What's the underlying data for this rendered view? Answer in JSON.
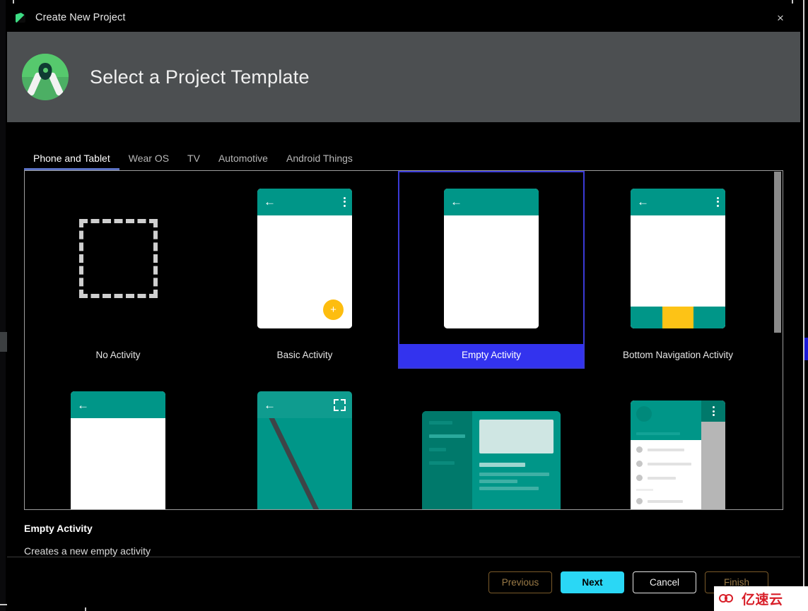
{
  "window": {
    "title": "Create New Project",
    "app_icon": "android-studio-icon",
    "close_label": "×"
  },
  "header": {
    "title": "Select a Project Template",
    "logo": "android-studio-logo"
  },
  "tabs": [
    {
      "label": "Phone and Tablet",
      "active": true
    },
    {
      "label": "Wear OS",
      "active": false
    },
    {
      "label": "TV",
      "active": false
    },
    {
      "label": "Automotive",
      "active": false
    },
    {
      "label": "Android Things",
      "active": false
    }
  ],
  "templates": [
    {
      "label": "No Activity",
      "thumb": "dashed-square",
      "selected": false
    },
    {
      "label": "Basic Activity",
      "thumb": "phone-fab",
      "selected": false
    },
    {
      "label": "Empty Activity",
      "thumb": "phone-plain",
      "selected": true
    },
    {
      "label": "Bottom Navigation Activity",
      "thumb": "phone-bottom-nav",
      "selected": false
    },
    {
      "label": "",
      "thumb": "phone-plain-2",
      "selected": false
    },
    {
      "label": "",
      "thumb": "fullscreen",
      "selected": false
    },
    {
      "label": "",
      "thumb": "master-detail",
      "selected": false
    },
    {
      "label": "",
      "thumb": "navigation-drawer",
      "selected": false
    }
  ],
  "description": {
    "title": "Empty Activity",
    "text": "Creates a new empty activity"
  },
  "footer": {
    "previous_label": "Previous",
    "next_label": "Next",
    "cancel_label": "Cancel",
    "finish_label": "Finish"
  },
  "watermark": {
    "text": "亿速云"
  },
  "colors": {
    "selection_blue": "#3333ee",
    "selection_border": "#3a3ad6",
    "material_teal": "#009688",
    "material_teal_dark": "#00796b",
    "amber": "#fdc316",
    "next_button": "#2ad7f5",
    "disabled_button_text": "#9a7a46",
    "header_bg": "#4c4f51",
    "tab_underline": "#5c73c4"
  }
}
